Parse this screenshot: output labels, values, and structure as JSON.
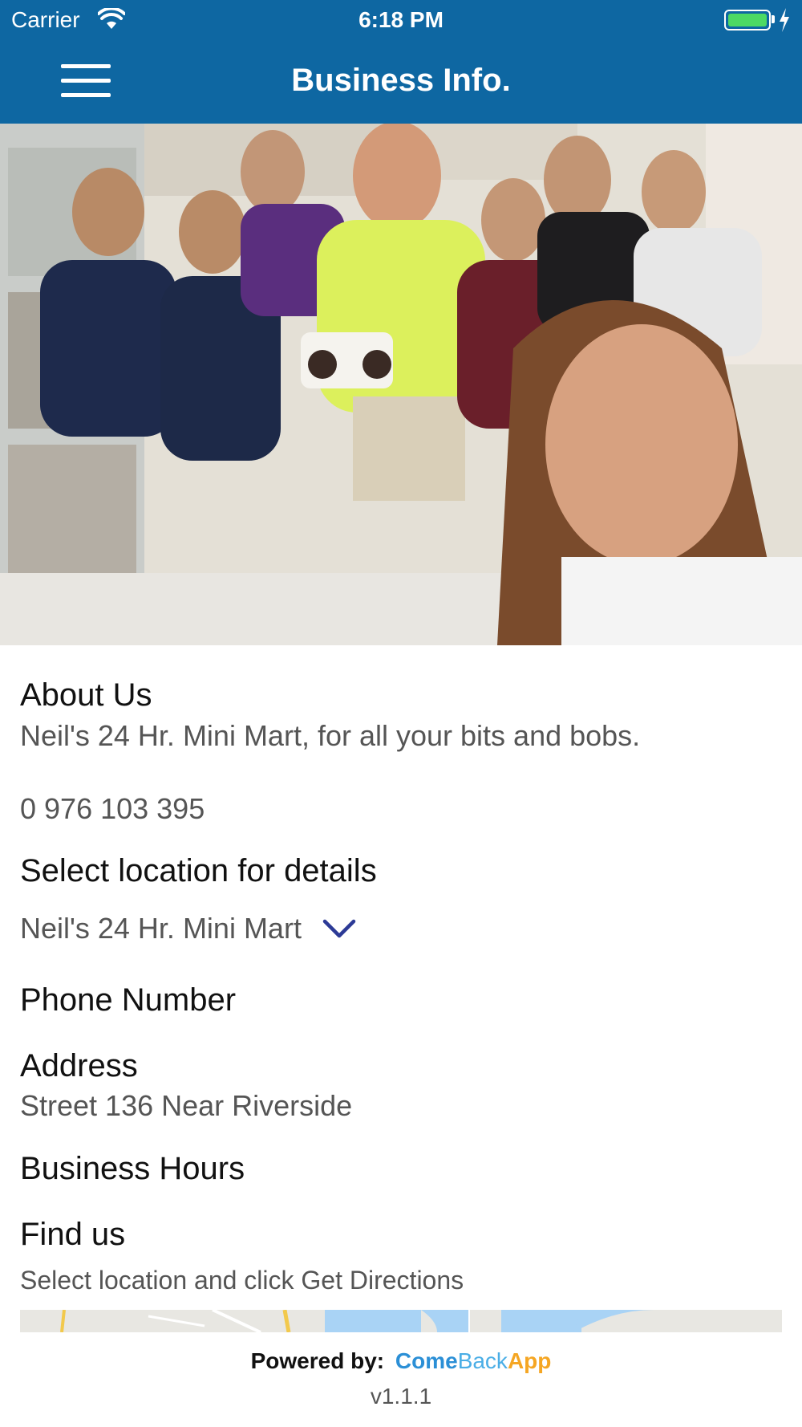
{
  "status_bar": {
    "carrier": "Carrier",
    "time": "6:18 PM",
    "battery_color": "#4cd964"
  },
  "nav": {
    "title": "Business Info.",
    "menu_icon": "hamburger-menu-icon",
    "bar_color": "#0e67a2"
  },
  "hero": {
    "image": "group-photo-store-birthday-cake"
  },
  "about": {
    "heading": "About Us",
    "text": "Neil's 24 Hr. Mini Mart, for all your bits and bobs.",
    "phone": "0 976 103 395"
  },
  "location": {
    "heading": "Select location for details",
    "selected": "Neil's 24 Hr. Mini Mart",
    "chevron_icon": "chevron-down-icon",
    "chevron_color": "#2c3a96"
  },
  "phone_section": {
    "heading": "Phone Number"
  },
  "address": {
    "heading": "Address",
    "text": "Street 136 Near Riverside"
  },
  "hours": {
    "heading": "Business Hours"
  },
  "find_us": {
    "heading": "Find us",
    "hint": "Select location and click Get Directions"
  },
  "footer": {
    "powered_label": "Powered by:",
    "brand_part1": "Come",
    "brand_part2": "Back",
    "brand_part3": "App",
    "version": "v1.1.1"
  }
}
